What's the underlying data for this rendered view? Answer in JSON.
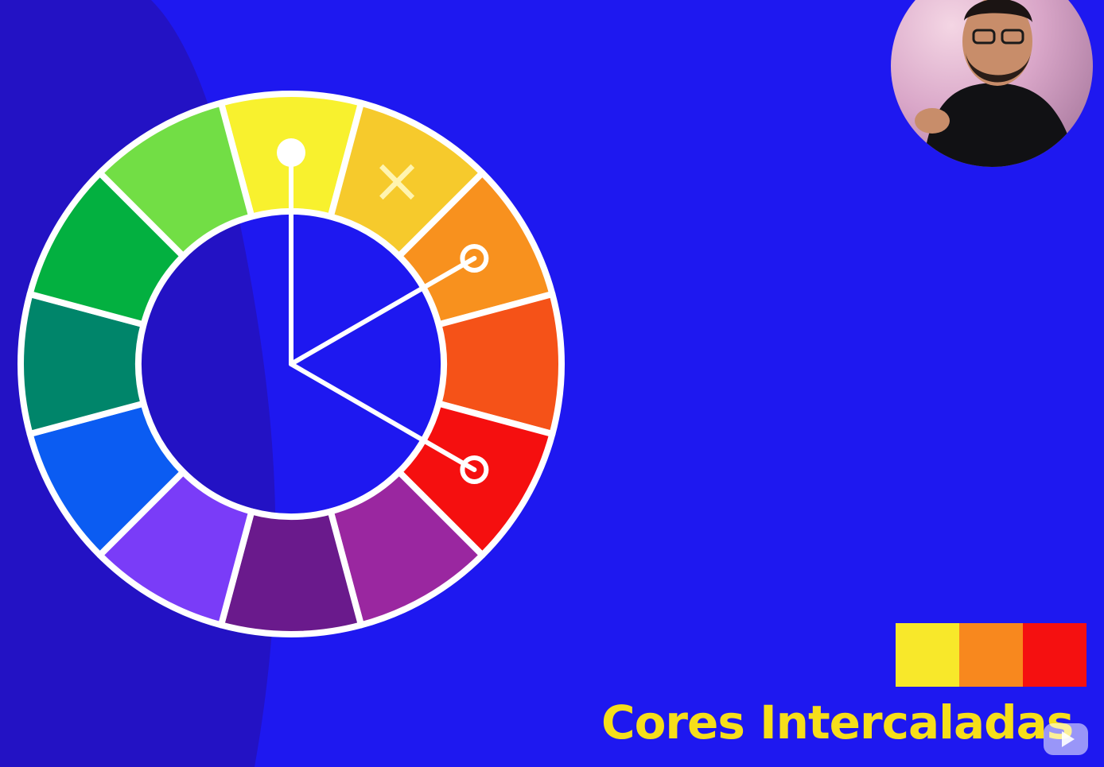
{
  "slide": {
    "title": "Cores Intercaladas",
    "title_color": "#f6de1a",
    "background_color": "#1e18f0",
    "shadow_color": "#2312c4"
  },
  "color_wheel": {
    "segments": [
      {
        "name": "yellow",
        "color": "#f8f12e"
      },
      {
        "name": "yellow-orange",
        "color": "#f6ca2c"
      },
      {
        "name": "orange",
        "color": "#f8911e"
      },
      {
        "name": "red-orange",
        "color": "#f55218"
      },
      {
        "name": "red",
        "color": "#f50f0f"
      },
      {
        "name": "red-violet",
        "color": "#9a27a0"
      },
      {
        "name": "violet",
        "color": "#6a1a8c"
      },
      {
        "name": "blue-violet",
        "color": "#7a3cf8"
      },
      {
        "name": "blue",
        "color": "#0b5cf2"
      },
      {
        "name": "blue-green",
        "color": "#00856a"
      },
      {
        "name": "green",
        "color": "#03b040"
      },
      {
        "name": "yellow-green",
        "color": "#72de45"
      }
    ],
    "pointer_targets": [
      "yellow",
      "orange",
      "red"
    ],
    "excluded_segment": "yellow-orange",
    "excluded_mark": "×"
  },
  "palette": {
    "swatches": [
      "#f8e82a",
      "#f8881e",
      "#f51010"
    ]
  },
  "webcam": {
    "icon": "presenter-webcam"
  },
  "watermark": {
    "icon": "watermark-logo-icon"
  }
}
